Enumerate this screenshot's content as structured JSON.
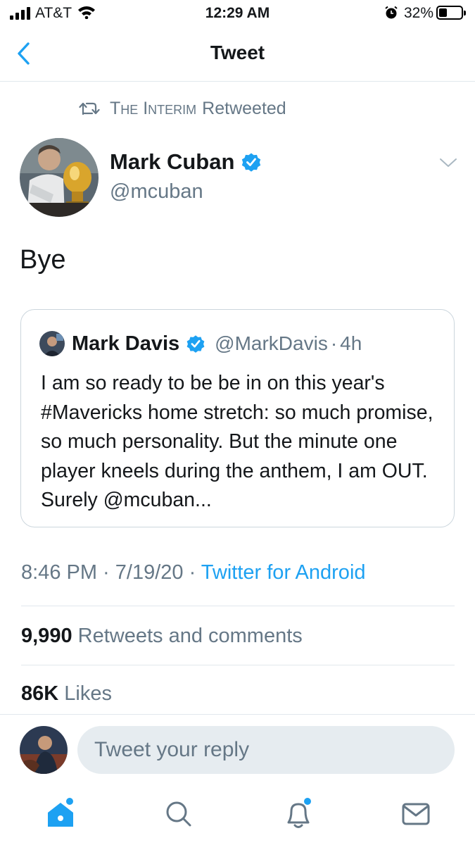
{
  "status_bar": {
    "carrier": "AT&T",
    "time": "12:29 AM",
    "battery": "32%",
    "battery_level": 0.32
  },
  "nav": {
    "back_icon": "chevron-left-icon",
    "title": "Tweet"
  },
  "retweet_context": {
    "icon": "retweet-icon",
    "user": "The Interim",
    "label": "Retweeted"
  },
  "tweet": {
    "author_name": "Mark Cuban",
    "author_handle": "@mcuban",
    "verified": true,
    "text": "Bye",
    "quoted": {
      "author_name": "Mark Davis",
      "author_handle": "@MarkDavis",
      "separator": "·",
      "time": "4h",
      "verified": true,
      "text": "I am so ready to be be in on this year's #Mavericks home stretch:  so much promise, so much personality.  But the minute one player kneels during the anthem, I am OUT. Surely @mcuban..."
    },
    "meta": {
      "time": "8:46 PM",
      "sep1": " · ",
      "date": "7/19/20",
      "sep2": " · ",
      "source": "Twitter for Android"
    },
    "stats": {
      "retweets_count": "9,990",
      "retweets_label": "Retweets and comments",
      "likes_count": "86K",
      "likes_label": "Likes"
    }
  },
  "reply": {
    "placeholder": "Tweet your reply"
  },
  "tab_bar": {
    "tabs": [
      "home-icon",
      "search-icon",
      "notifications-icon",
      "messages-icon"
    ],
    "accent_color": "#1da1f2"
  },
  "colors": {
    "accent": "#1da1f2",
    "secondary_text": "#657786",
    "primary_text": "#14171a",
    "border": "#e1e8ed"
  }
}
